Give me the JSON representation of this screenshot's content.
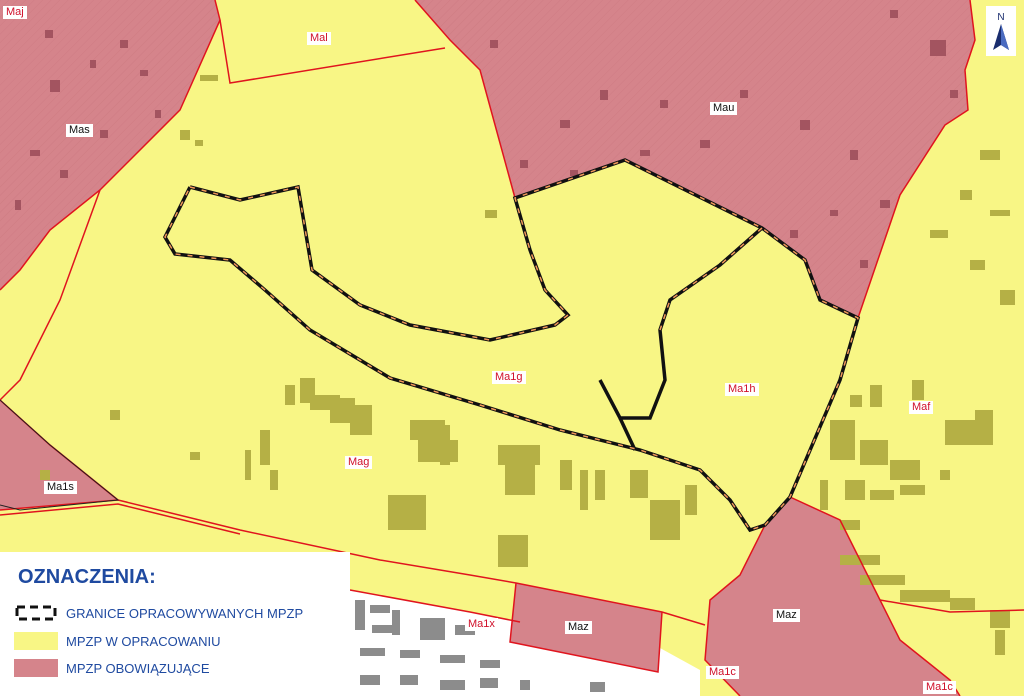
{
  "map": {
    "colors": {
      "mpzp_in_progress": "#f8f685",
      "mpzp_in_force": "#d5848b",
      "boundary_red": "#e0141e",
      "study_boundary": "#111111",
      "buildings_yellow_zone": "#b5b045",
      "buildings_pink_zone": "#a35460",
      "buildings_white_zone": "#8c8c8c"
    },
    "zone_labels": [
      {
        "id": "maj",
        "text": "Maj"
      },
      {
        "id": "mal",
        "text": "Mal"
      },
      {
        "id": "mas",
        "text": "Mas"
      },
      {
        "id": "mau",
        "text": "Mau"
      },
      {
        "id": "malg",
        "text": "Ma1g"
      },
      {
        "id": "malh",
        "text": "Ma1h"
      },
      {
        "id": "maf",
        "text": "Maf"
      },
      {
        "id": "mag",
        "text": "Mag"
      },
      {
        "id": "mals",
        "text": "Ma1s"
      },
      {
        "id": "maz1",
        "text": "Maz"
      },
      {
        "id": "maz2",
        "text": "Maz"
      },
      {
        "id": "malx",
        "text": "Ma1x"
      },
      {
        "id": "malc1",
        "text": "Ma1c"
      },
      {
        "id": "malc2",
        "text": "Ma1c"
      }
    ],
    "north_arrow": {
      "letter": "N",
      "icon": "north-arrow-icon"
    }
  },
  "legend": {
    "title": "OZNACZENIA:",
    "items": [
      {
        "label": "GRANICE OPRACOWYWANYCH MPZP",
        "icon": "dashed-boundary-icon"
      },
      {
        "label": "MPZP W OPRACOWANIU",
        "color": "#f8f685"
      },
      {
        "label": "MPZP OBOWIĄZUJĄCE",
        "color": "#d5848b"
      }
    ]
  }
}
